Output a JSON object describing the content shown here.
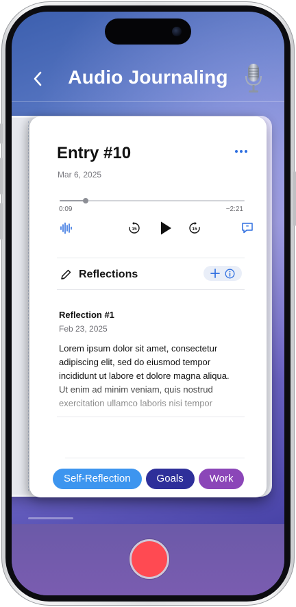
{
  "header": {
    "title": "Audio Journaling",
    "back_icon": "chevron-left-icon",
    "mic_icon": "microphone-icon"
  },
  "entry": {
    "title": "Entry #10",
    "date": "Mar 6, 2025",
    "player": {
      "current_time": "0:09",
      "remaining_time": "−2:21",
      "progress": 0.14,
      "skip_back_label": "15",
      "skip_forward_label": "15"
    }
  },
  "reflections": {
    "heading": "Reflections",
    "items": [
      {
        "title": "Reflection #1",
        "date": "Feb 23, 2025",
        "body": "Lorem ipsum dolor sit amet, consectetur adipiscing elit, sed do eiusmod tempor incididunt ut labore et dolore magna aliqua. Ut enim ad minim veniam, quis nostrud exercitation ullamco laboris nisi tempor"
      }
    ]
  },
  "tags": [
    {
      "label": "Self-Reflection",
      "color": "#3d95ef"
    },
    {
      "label": "Goals",
      "color": "#2e2f9a"
    },
    {
      "label": "Work",
      "color": "#8b46b8"
    }
  ],
  "colors": {
    "accent": "#2f6fe0",
    "record": "#ff4a52"
  }
}
